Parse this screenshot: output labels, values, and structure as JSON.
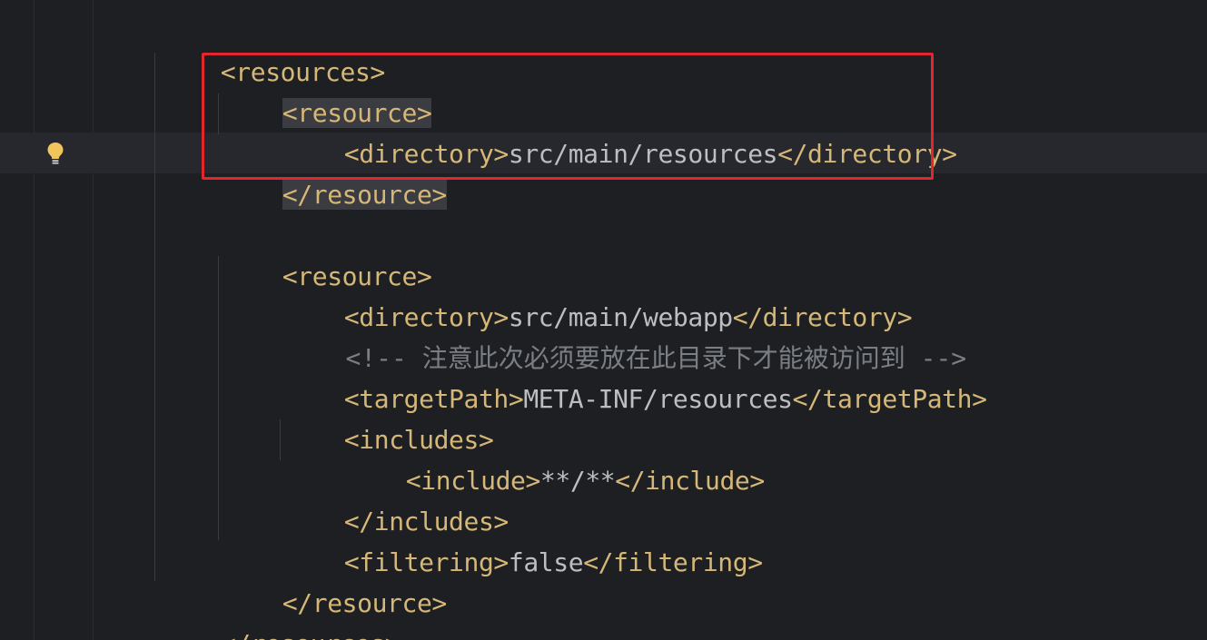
{
  "accent_colors": {
    "tag": "#d5b778",
    "text": "#bcbec4",
    "comment": "#7a7e85",
    "highlight_box": "#e3262e",
    "background": "#1e1f22"
  },
  "gutter": {
    "intention_icon": "lightbulb-icon"
  },
  "code": {
    "line1": {
      "tag": "<resources>"
    },
    "line2": {
      "tag": "<resource>"
    },
    "line3": {
      "open": "<directory>",
      "text": "src/main/resources",
      "close": "</directory>"
    },
    "line4": {
      "tag": "</resource>"
    },
    "line6": {
      "tag": "<resource>"
    },
    "line7": {
      "open": "<directory>",
      "text": "src/main/webapp",
      "close": "</directory>"
    },
    "line8": {
      "comment": "<!-- 注意此次必须要放在此目录下才能被访问到 -->"
    },
    "line9": {
      "open": "<targetPath>",
      "text": "META-INF/resources",
      "close": "</targetPath>"
    },
    "line10": {
      "tag": "<includes>"
    },
    "line11": {
      "open": "<include>",
      "text": "**/**",
      "close": "</include>"
    },
    "line12": {
      "tag": "</includes>"
    },
    "line13": {
      "open": "<filtering>",
      "text": "false",
      "close": "</filtering>"
    },
    "line14": {
      "tag": "</resource>"
    },
    "line15": {
      "tag": "</resources>"
    }
  }
}
